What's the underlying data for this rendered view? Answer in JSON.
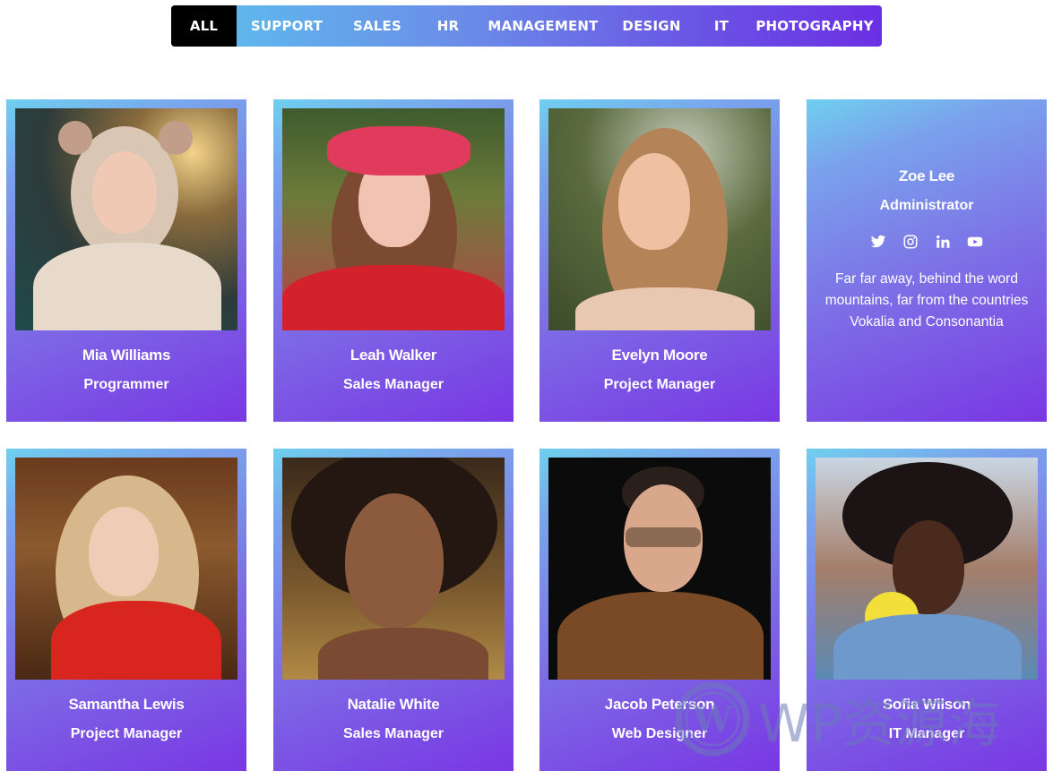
{
  "filters": [
    {
      "label": "ALL",
      "active": true
    },
    {
      "label": "SUPPORT",
      "active": false
    },
    {
      "label": "SALES",
      "active": false
    },
    {
      "label": "HR",
      "active": false
    },
    {
      "label": "MANAGEMENT",
      "active": false
    },
    {
      "label": "DESIGN",
      "active": false
    },
    {
      "label": "IT",
      "active": false
    },
    {
      "label": "PHOTOGRAPHY",
      "active": false
    }
  ],
  "team": [
    {
      "name": "Mia Williams",
      "role": "Programmer"
    },
    {
      "name": "Leah Walker",
      "role": "Sales Manager"
    },
    {
      "name": "Evelyn Moore",
      "role": "Project Manager"
    },
    {
      "name": "Samantha Lewis",
      "role": "Project Manager"
    },
    {
      "name": "Natalie White",
      "role": "Sales Manager"
    },
    {
      "name": "Jacob Peterson",
      "role": "Web Designer"
    },
    {
      "name": "Sofia Wilson",
      "role": "IT Manager"
    }
  ],
  "featured": {
    "name": "Zoe Lee",
    "role": "Administrator",
    "bio": "Far far away, behind the word mountains, far from the countries Vokalia and Consonantia",
    "socials": [
      "twitter-icon",
      "instagram-icon",
      "linkedin-icon",
      "youtube-icon"
    ]
  },
  "watermark": {
    "text": "WP资源海"
  },
  "colors": {
    "gradient_start": "#6fd0ee",
    "gradient_end": "#7937e3",
    "active_filter": "#000000"
  }
}
